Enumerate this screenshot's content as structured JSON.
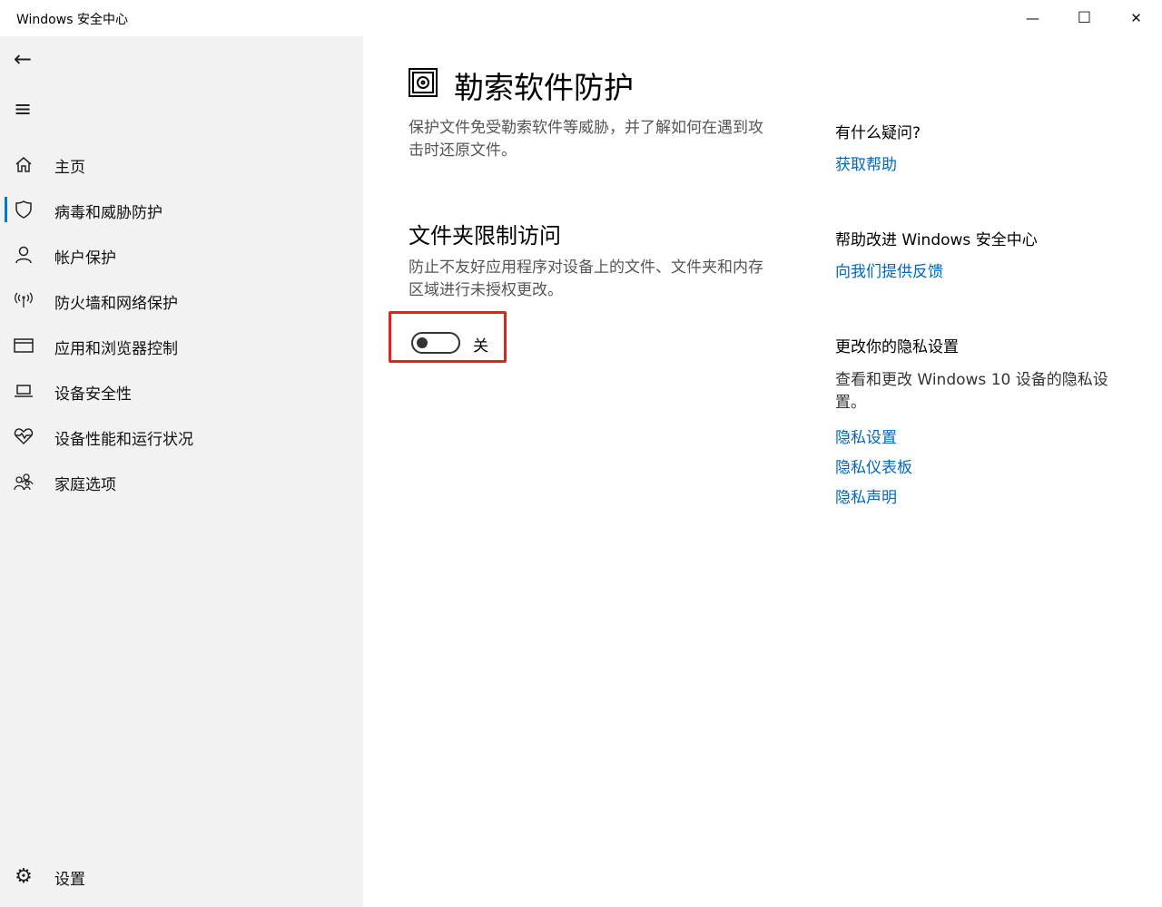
{
  "window": {
    "title": "Windows 安全中心",
    "minimize": "—",
    "maximize": "☐",
    "close": "✕"
  },
  "sidebar": {
    "back_icon": "←",
    "menu_icon": "≡",
    "items": [
      {
        "label": "主页",
        "icon": "home-icon"
      },
      {
        "label": "病毒和威胁防护",
        "icon": "shield-icon",
        "selected": true
      },
      {
        "label": "帐户保护",
        "icon": "person-icon"
      },
      {
        "label": "防火墙和网络保护",
        "icon": "wifi-antenna-icon"
      },
      {
        "label": "应用和浏览器控制",
        "icon": "browser-window-icon"
      },
      {
        "label": "设备安全性",
        "icon": "laptop-icon"
      },
      {
        "label": "设备性能和运行状况",
        "icon": "heart-icon"
      },
      {
        "label": "家庭选项",
        "icon": "family-icon"
      }
    ],
    "settings": {
      "label": "设置",
      "icon": "gear-icon"
    }
  },
  "main": {
    "title": "勒索软件防护",
    "description": "保护文件免受勒索软件等威胁，并了解如何在遇到攻击时还原文件。",
    "section_title": "文件夹限制访问",
    "section_description": "防止不友好应用程序对设备上的文件、文件夹和内存区域进行未授权更改。",
    "toggle": {
      "state": "off",
      "label": "关"
    }
  },
  "right": {
    "question_heading": "有什么疑问?",
    "get_help": "获取帮助",
    "improve_heading": "帮助改进 Windows 安全中心",
    "feedback": "向我们提供反馈",
    "privacy_heading": "更改你的隐私设置",
    "privacy_desc": "查看和更改 Windows 10 设备的隐私设置。",
    "privacy_links": [
      "隐私设置",
      "隐私仪表板",
      "隐私声明"
    ]
  },
  "colors": {
    "accent": "#0078d7",
    "link": "#0067c0",
    "highlight": "#e8201a"
  }
}
